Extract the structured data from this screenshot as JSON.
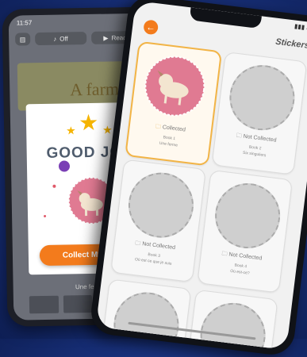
{
  "left_phone": {
    "status": {
      "time": "11:57",
      "icons": "▾ ▮▮▮ ■"
    },
    "toolbar": {
      "off_label": "Off",
      "read_label": "Read to Me"
    },
    "book_title": "A farm.",
    "book_footer": "Une ferme",
    "popup": {
      "close_symbol": "×",
      "headline": "GOOD JOB",
      "collect_button": "Collect My Sticker"
    }
  },
  "right_phone": {
    "title": "Stickers",
    "back_symbol": "←",
    "cards": [
      {
        "status": "Collected",
        "book": "Book 1",
        "sub": "Une ferme"
      },
      {
        "status": "Not Collected",
        "book": "Book 2",
        "sub": "Six singuliers"
      },
      {
        "status": "Not Collected",
        "book": "Book 3",
        "sub": "Où est ce que je suis"
      },
      {
        "status": "Not Collected",
        "book": "Book 4",
        "sub": "Où est-ce?"
      }
    ]
  },
  "colors": {
    "accent": "#f37b1c",
    "collected_border": "#f2b446",
    "sticker_pink": "#e07a92"
  }
}
